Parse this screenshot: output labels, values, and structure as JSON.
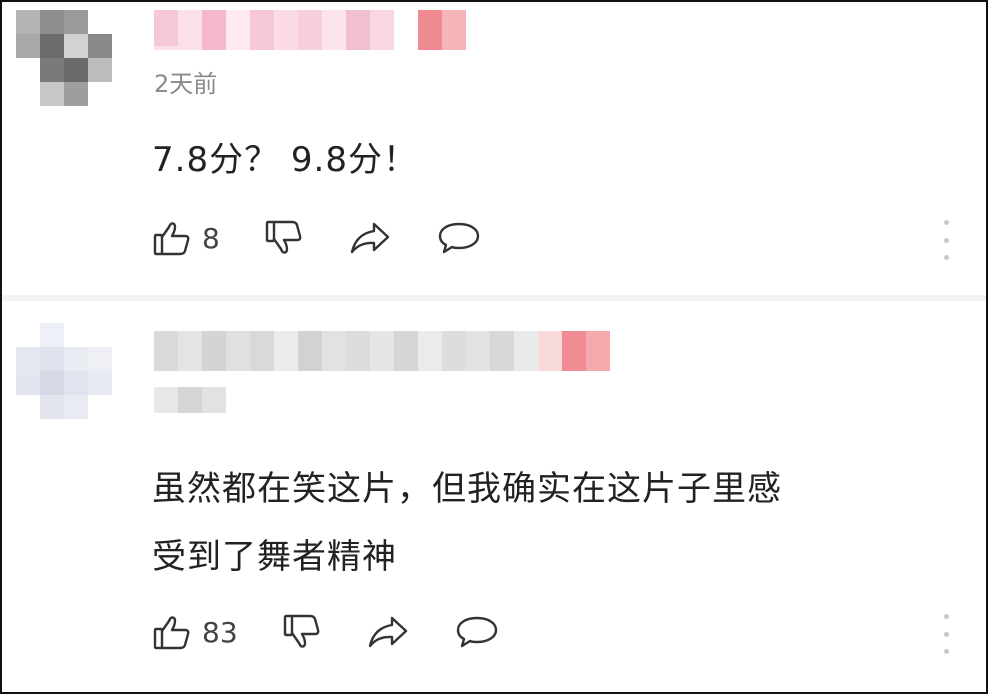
{
  "comments": [
    {
      "time": "2天前",
      "text": "7.8分？ 9.8分！",
      "likes": "8"
    },
    {
      "time": "",
      "text_line1": "虽然都在笑这片，但我确实在这片子里感",
      "text_line2": "受到了舞者精神",
      "likes": "83"
    }
  ],
  "icons": {
    "like": "thumbs-up-icon",
    "dislike": "thumbs-down-icon",
    "share": "share-arrow-icon",
    "reply": "speech-bubble-icon",
    "more": "vertical-dots-icon"
  }
}
